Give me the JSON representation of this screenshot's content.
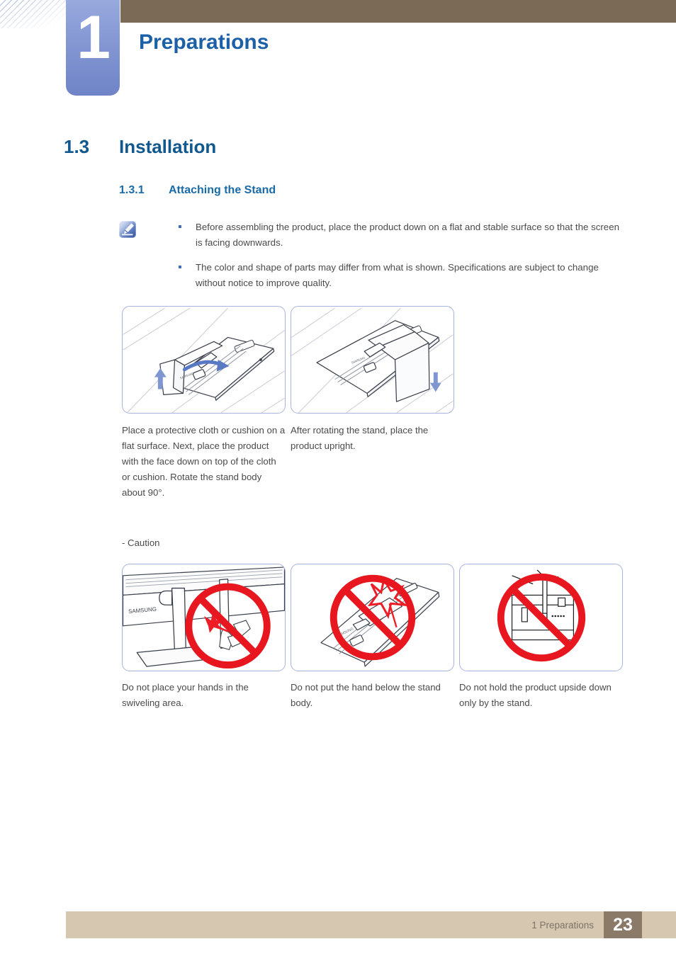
{
  "header": {
    "chapter_number": "1",
    "chapter_title": "Preparations",
    "bar_color": "#7a6a56",
    "badge_color": "#8497d3",
    "title_color": "#1c60a8"
  },
  "section": {
    "number": "1.3",
    "title": "Installation",
    "color": "#11588f"
  },
  "subsection": {
    "number": "1.3.1",
    "title": "Attaching the Stand",
    "color": "#1a6aa8"
  },
  "note": {
    "icon": "note-pencil-icon",
    "bullets": [
      "Before assembling the product, place the product down on a flat and stable surface so that the screen is facing downwards.",
      "The color and shape of parts may differ from what is shown. Specifications are subject to change without notice to improve quality."
    ]
  },
  "steps": {
    "panels": [
      {
        "alt": "monitor-face-down-rotate-stand-illustration"
      },
      {
        "alt": "monitor-stand-rotated-upright-illustration"
      }
    ],
    "captions": [
      "Place a protective cloth or cushion on a flat surface. Next, place the product with the face down on top of the cloth or cushion. Rotate the stand body about 90°.",
      "After rotating the stand, place the product upright."
    ]
  },
  "caution": {
    "label": "- Caution",
    "panels": [
      {
        "alt": "no-hands-in-swivel-area-illustration"
      },
      {
        "alt": "no-hand-below-stand-body-illustration"
      },
      {
        "alt": "no-holding-upside-down-by-stand-illustration"
      }
    ],
    "captions": [
      "Do not place your hands in the swiveling area.",
      "Do not put the hand below the stand body.",
      "Do not hold the product upside down only by the stand."
    ]
  },
  "footer": {
    "chapter_ref": "1 Preparations",
    "page_number": "23",
    "bar_color": "#d6c8b0",
    "page_box_color": "#8b7a68"
  }
}
